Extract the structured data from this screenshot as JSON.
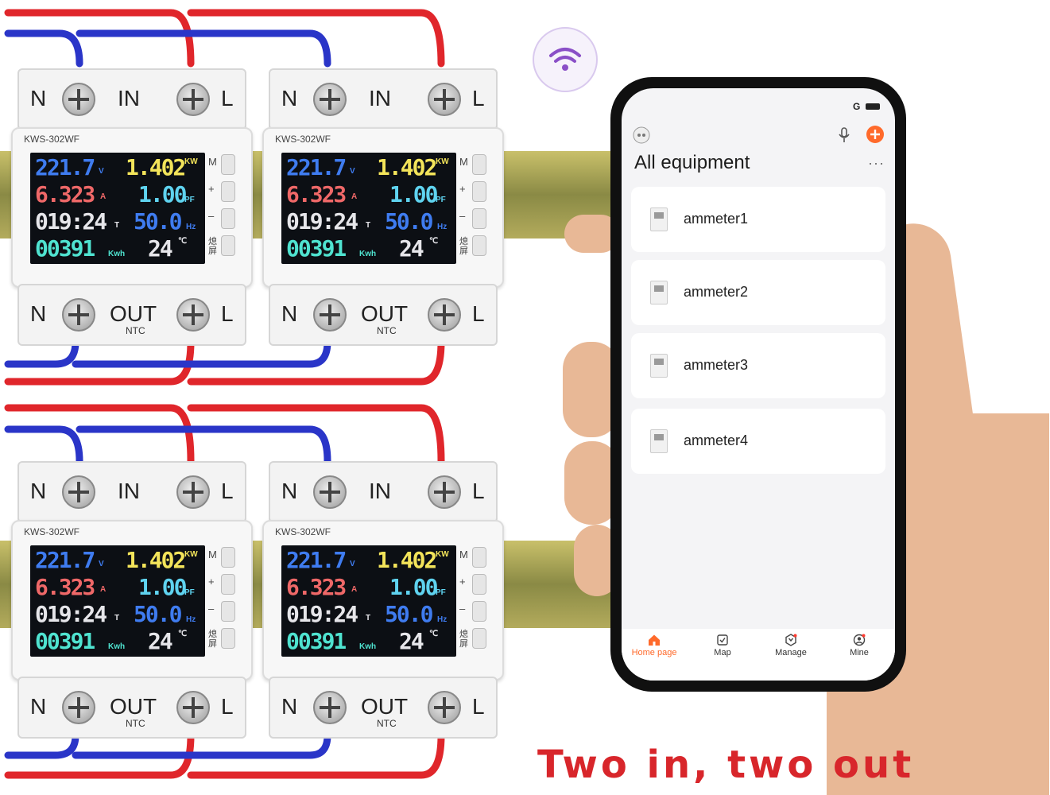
{
  "meters": {
    "model": "KWS-302WF",
    "top_terminals": {
      "left": "N",
      "middle": "IN",
      "right": "L"
    },
    "bottom_terminals": {
      "left": "N",
      "middle": "OUT",
      "sub": "NTC",
      "right": "L"
    },
    "readings": {
      "voltage": "221.7",
      "voltage_unit": "V",
      "power": "1.402",
      "power_unit": "KW",
      "current": "6.323",
      "current_unit": "A",
      "pf": "1.00",
      "pf_unit": "PF",
      "time": "019:24",
      "time_unit": "T",
      "freq": "50.0",
      "freq_unit": "Hz",
      "energy": "00391",
      "energy_unit": "Kwh",
      "temp": "24",
      "temp_unit": "℃"
    },
    "buttons": [
      "M",
      "+",
      "–",
      "熄屏"
    ]
  },
  "phone": {
    "status": {
      "carrier": "G"
    },
    "header": {
      "title": "All equipment",
      "more": "···",
      "icons": [
        "robot-icon",
        "mic-icon",
        "add-icon"
      ]
    },
    "devices": [
      "ammeter1",
      "ammeter2",
      "ammeter3",
      "ammeter4"
    ],
    "tabs": [
      {
        "label": "Home page",
        "icon": "home-icon",
        "active": true
      },
      {
        "label": "Map",
        "icon": "map-icon",
        "active": false
      },
      {
        "label": "Manage",
        "icon": "manage-icon",
        "active": false
      },
      {
        "label": "Mine",
        "icon": "user-icon",
        "active": false
      }
    ],
    "accent": "#ff6a2b"
  },
  "caption": "Two in, two out",
  "colors": {
    "live_wire": "#e0262b",
    "neutral_wire": "#2a35c8",
    "caption": "#d8262b"
  }
}
